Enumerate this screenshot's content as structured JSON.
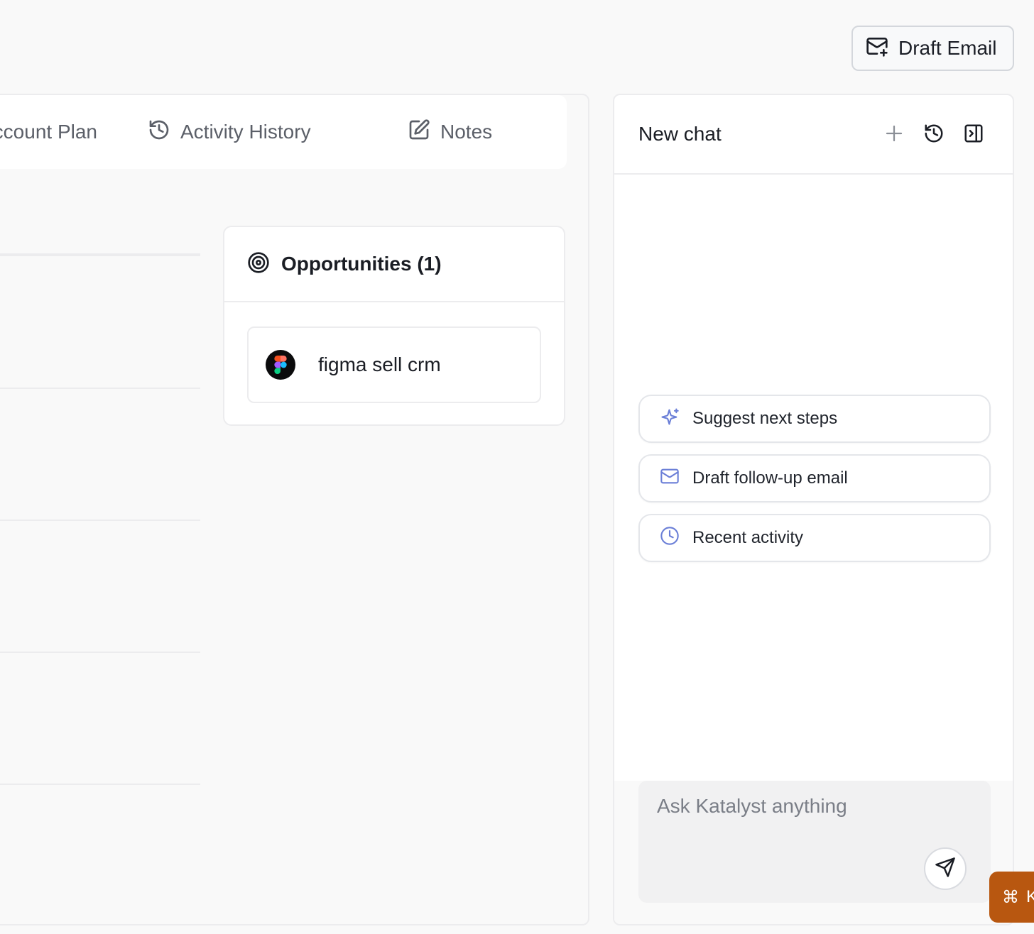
{
  "header": {
    "draft_email_label": "Draft Email"
  },
  "tabs": [
    {
      "label": "Account Plan",
      "icon": "account-plan-icon"
    },
    {
      "label": "Activity History",
      "icon": "history-icon"
    },
    {
      "label": "Notes",
      "icon": "edit-icon"
    }
  ],
  "opportunities": {
    "title": "Opportunities (1)",
    "icon": "target-icon",
    "items": [
      {
        "name": "figma sell crm",
        "icon": "figma-logo"
      }
    ]
  },
  "chat": {
    "title": "New chat",
    "suggestions": [
      {
        "label": "Suggest next steps",
        "icon": "sparkle-icon"
      },
      {
        "label": "Draft follow-up email",
        "icon": "mail-icon"
      },
      {
        "label": "Recent activity",
        "icon": "clock-icon"
      }
    ],
    "input_placeholder": "Ask Katalyst anything"
  },
  "shortcut": {
    "glyph": "⌘",
    "label": "K"
  },
  "colors": {
    "accent_icon": "#6b7fd7",
    "shortcut_bg": "#b85710",
    "page_bg": "#f9f9f9"
  }
}
